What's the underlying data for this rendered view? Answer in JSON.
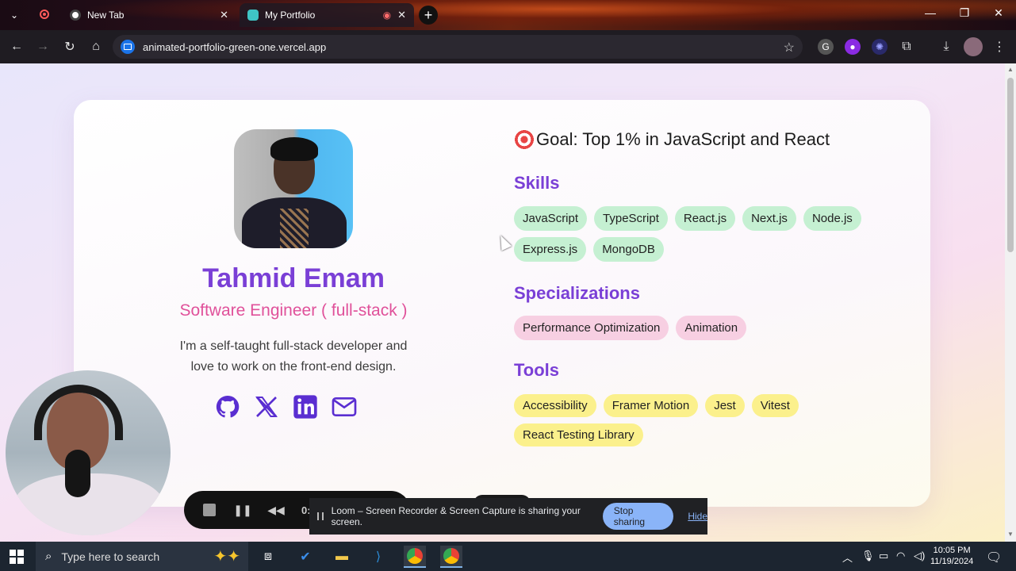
{
  "browser": {
    "tabs": [
      {
        "title": "New Tab",
        "active": false
      },
      {
        "title": "My Portfolio",
        "active": true
      }
    ],
    "url": "animated-portfolio-green-one.vercel.app"
  },
  "profile": {
    "name": "Tahmid Emam",
    "role": "Software Engineer ( full-stack )",
    "bio": "I'm a self-taught full-stack developer and love to work on the front-end design.",
    "socials": [
      "github-icon",
      "x-icon",
      "linkedin-icon",
      "email-icon"
    ]
  },
  "goal": "Goal: Top 1% in JavaScript and React",
  "skills": {
    "title": "Skills",
    "items": [
      "JavaScript",
      "TypeScript",
      "React.js",
      "Next.js",
      "Node.js",
      "Express.js",
      "MongoDB"
    ]
  },
  "specializations": {
    "title": "Specializations",
    "items": [
      "Performance Optimization",
      "Animation"
    ]
  },
  "tools": {
    "title": "Tools",
    "items": [
      "Accessibility",
      "Framer Motion",
      "Jest",
      "Vitest",
      "React Testing Library"
    ]
  },
  "loom": {
    "time": "0:00",
    "share_message": "Loom – Screen Recorder & Screen Capture is sharing your screen.",
    "stop_label": "Stop sharing",
    "hide_label": "Hide"
  },
  "taskbar": {
    "search_placeholder": "Type here to search",
    "time": "10:05 PM",
    "date": "11/19/2024"
  },
  "colors": {
    "accent_purple": "#7a3fd6",
    "role_pink": "#e0519a",
    "skill_chip": "#c5f0d2",
    "spec_chip": "#f7cfe2",
    "tool_chip": "#fbf08c"
  }
}
